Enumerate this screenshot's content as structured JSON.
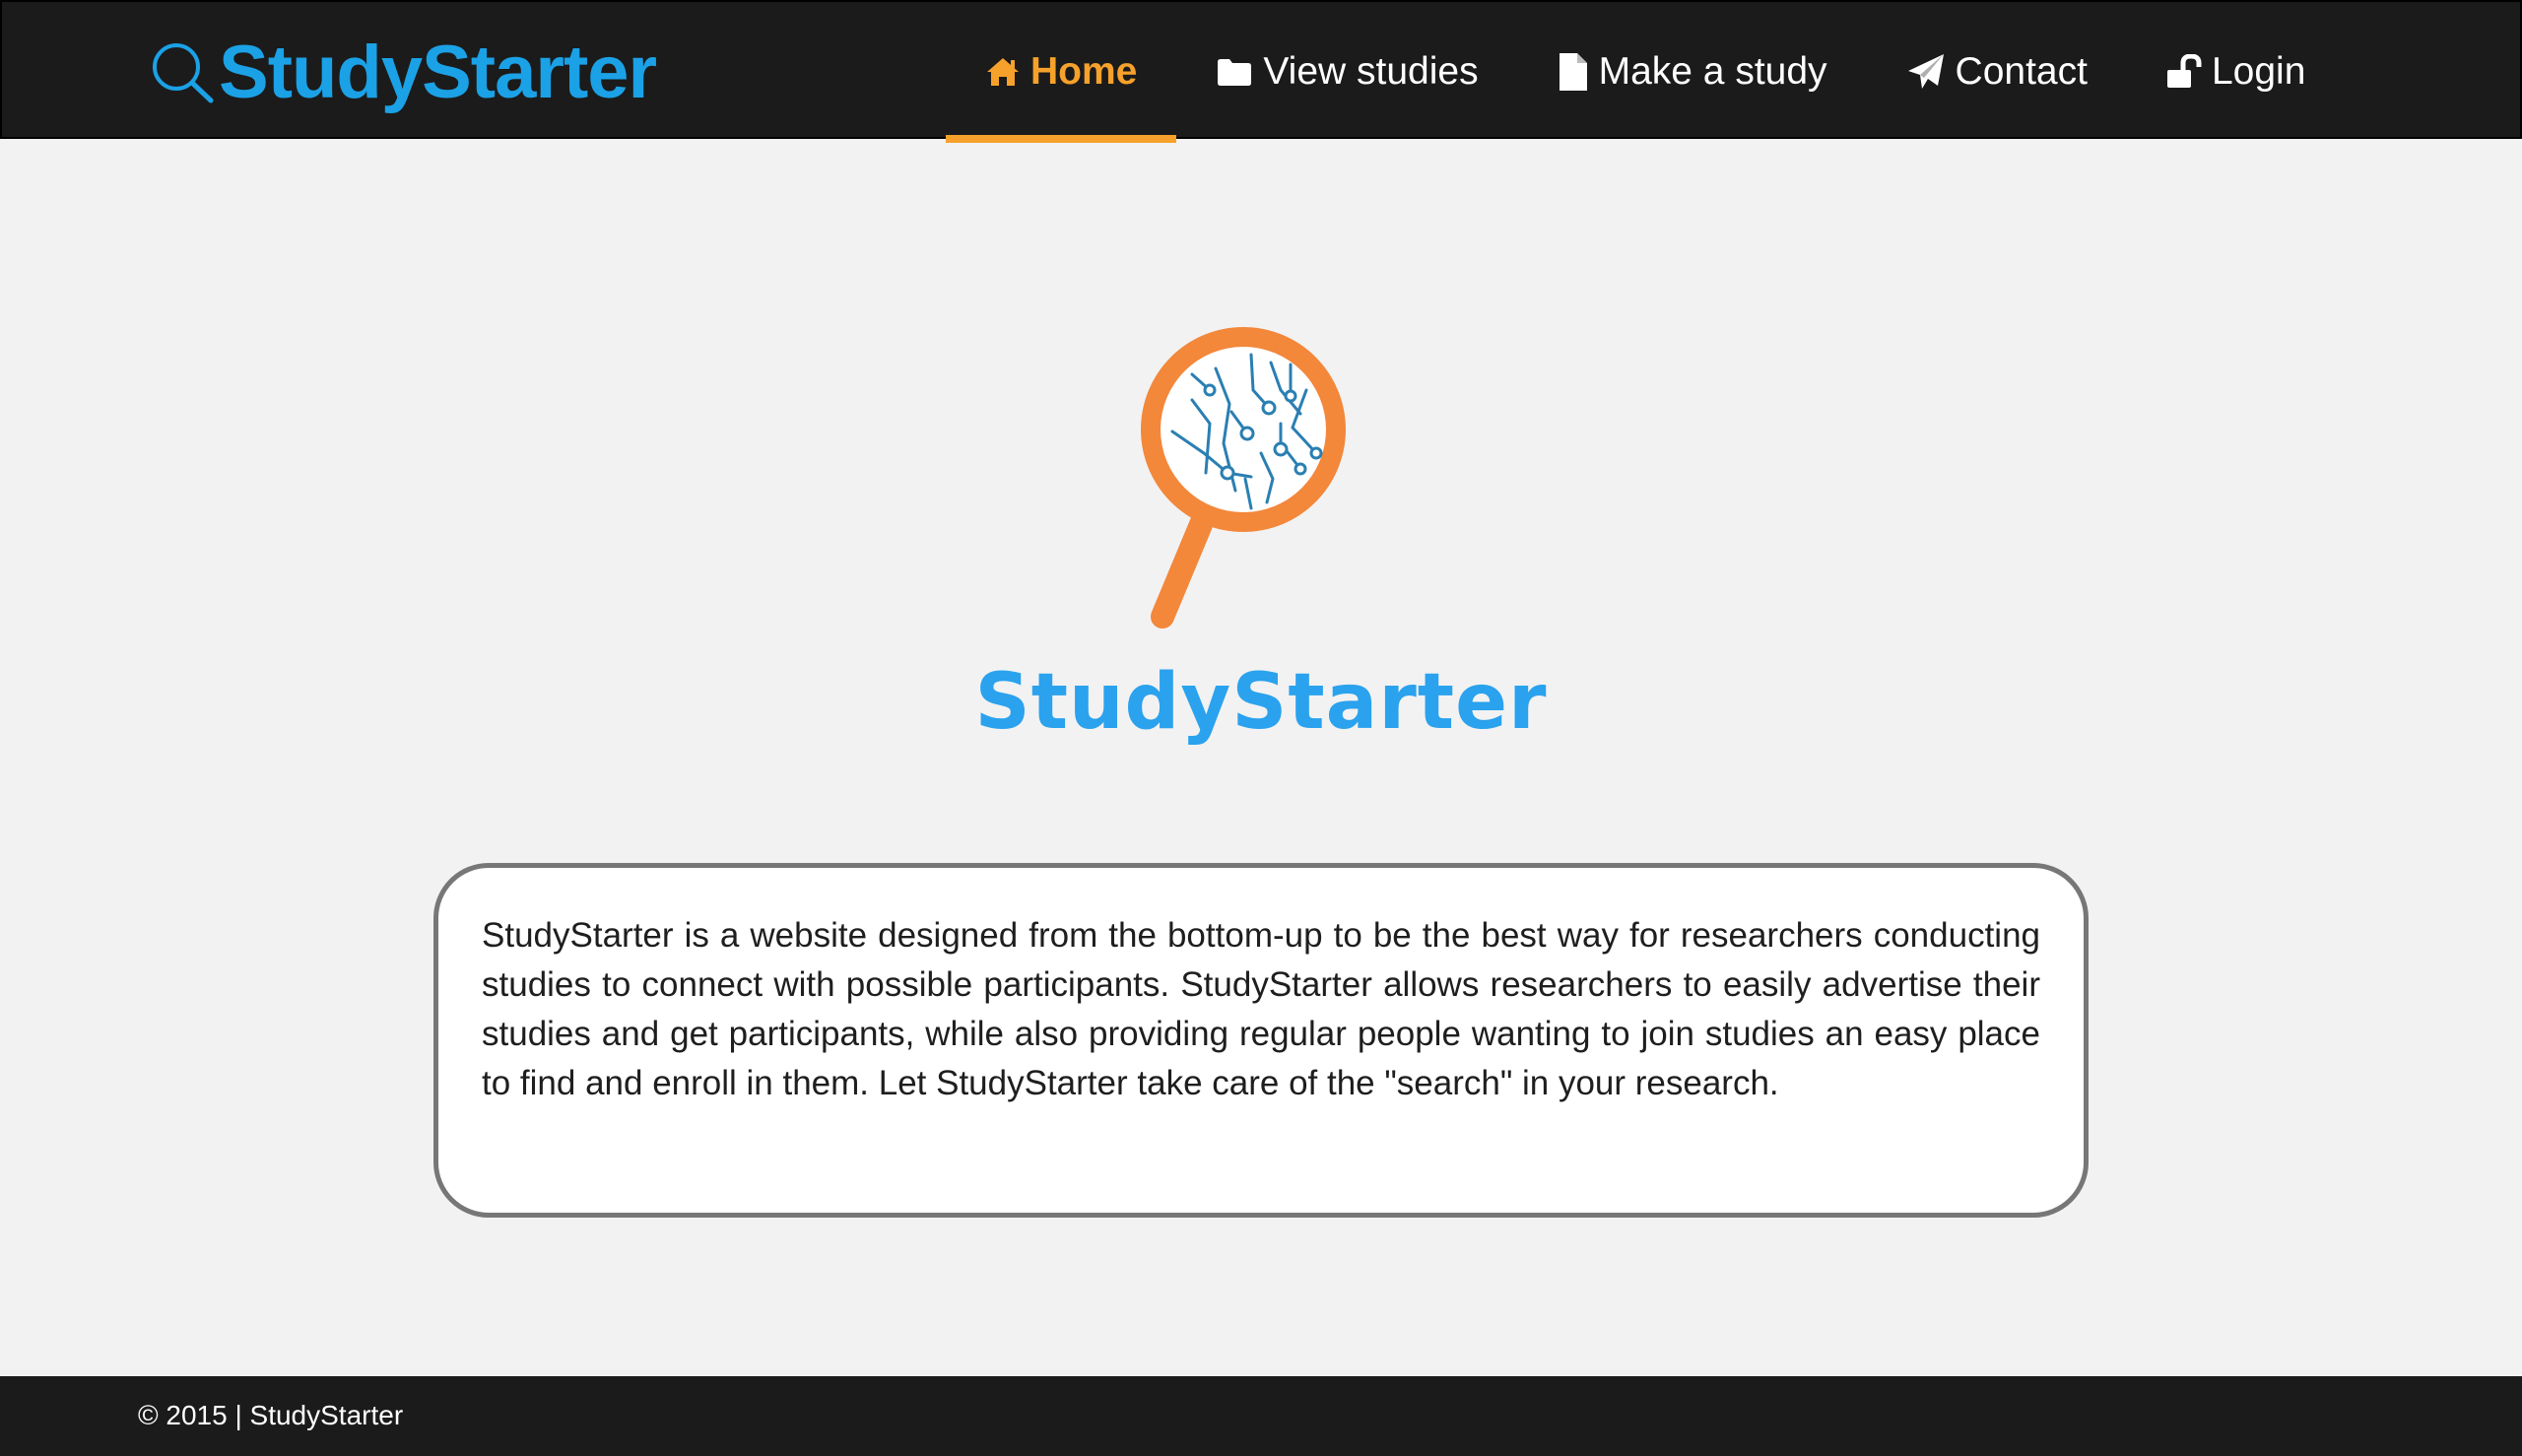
{
  "brand": {
    "name": "StudyStarter",
    "icon": "magnifier-icon",
    "color": "#1ba1e6"
  },
  "nav": {
    "items": [
      {
        "label": "Home",
        "icon": "home-icon",
        "active": true
      },
      {
        "label": "View studies",
        "icon": "folder-icon",
        "active": false
      },
      {
        "label": "Make a study",
        "icon": "document-icon",
        "active": false
      },
      {
        "label": "Contact",
        "icon": "paper-plane-icon",
        "active": false
      },
      {
        "label": "Login",
        "icon": "unlock-icon",
        "active": false
      }
    ],
    "active_color": "#f6a12b"
  },
  "hero": {
    "logo_text": "StudyStarter",
    "logo_icon": "magnifier-circuit-icon",
    "logo_colors": {
      "ring": "#f3873a",
      "circuit": "#2a7fb2",
      "text": "#2aa2ee"
    }
  },
  "about": {
    "text": "StudyStarter is a website designed from the bottom-up to be the best way for researchers conducting studies to connect with possible participants. StudyStarter allows researchers to easily advertise their studies and get participants, while also providing regular people wanting to join studies an easy place to find and enroll in them. Let StudyStarter take care of the \"search\" in your research."
  },
  "footer": {
    "text": "© 2015 | StudyStarter"
  }
}
